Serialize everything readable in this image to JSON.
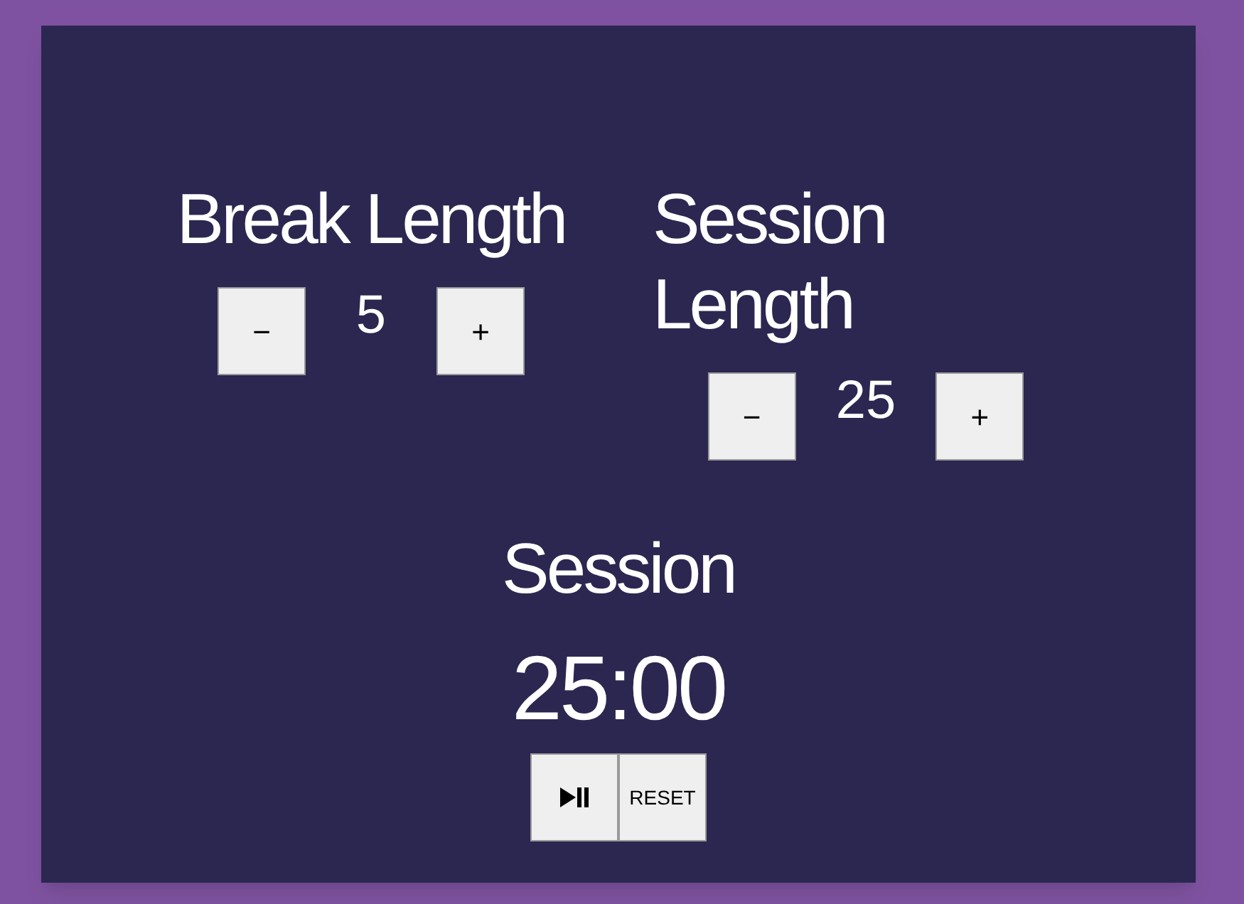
{
  "lengths": [
    {
      "title": "Break Length",
      "decrement": "−",
      "value": "5",
      "increment": "+"
    },
    {
      "title": "Session Length",
      "decrement": "−",
      "value": "25",
      "increment": "+"
    }
  ],
  "timer": {
    "label": "Session",
    "time": "25:00"
  },
  "controls": [
    {
      "kind": "play_pause"
    },
    {
      "kind": "reset",
      "label": "RESET"
    }
  ]
}
